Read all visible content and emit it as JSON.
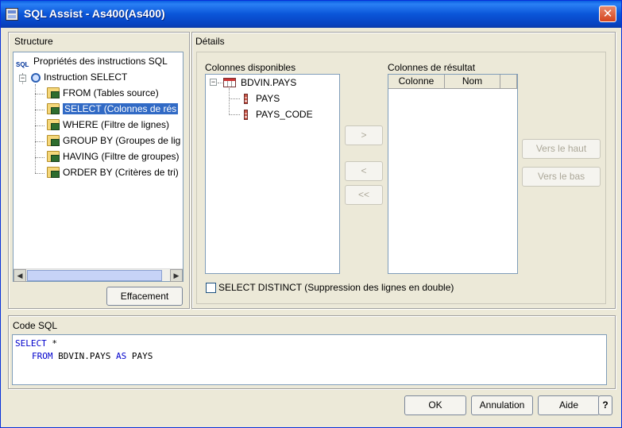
{
  "window": {
    "title": "SQL Assist - As400(As400)",
    "close_glyph": "✕"
  },
  "structure": {
    "label": "Structure",
    "root": "Propriétés des instructions SQL",
    "select_node": "Instruction SELECT",
    "items": [
      "FROM (Tables source)",
      "SELECT (Colonnes de rés",
      "WHERE (Filtre de lignes)",
      "GROUP BY (Groupes de lig",
      "HAVING (Filtre de groupes)",
      "ORDER BY (Critères de tri)"
    ],
    "selected_index": 1,
    "clear_button": "Effacement",
    "sql_icon_text": "SQL"
  },
  "details": {
    "label": "Détails",
    "available_label": "Colonnes disponibles",
    "table_name": "BDVIN.PAYS",
    "columns": [
      "PAYS",
      "PAYS_CODE"
    ],
    "result_label": "Colonnes de résultat",
    "result_headers": [
      "Colonne",
      "Nom"
    ],
    "add_button": ">",
    "remove_button": "<",
    "remove_all_button": "<<",
    "move_up_button": "Vers le haut",
    "move_down_button": "Vers le bas",
    "distinct_label": "SELECT DISTINCT (Suppression des lignes en double)",
    "distinct_checked": false
  },
  "sql": {
    "label": "Code SQL",
    "line1_kw": "SELECT",
    "line1_rest": " *",
    "line2_kw1": "FROM",
    "line2_mid": " BDVIN.PAYS ",
    "line2_kw2": "AS",
    "line2_rest": " PAYS"
  },
  "footer": {
    "ok": "OK",
    "cancel": "Annulation",
    "help": "Aide",
    "question": "?"
  },
  "scroll": {
    "left_glyph": "◀",
    "right_glyph": "▶"
  },
  "tree_glyphs": {
    "minus": "−"
  }
}
